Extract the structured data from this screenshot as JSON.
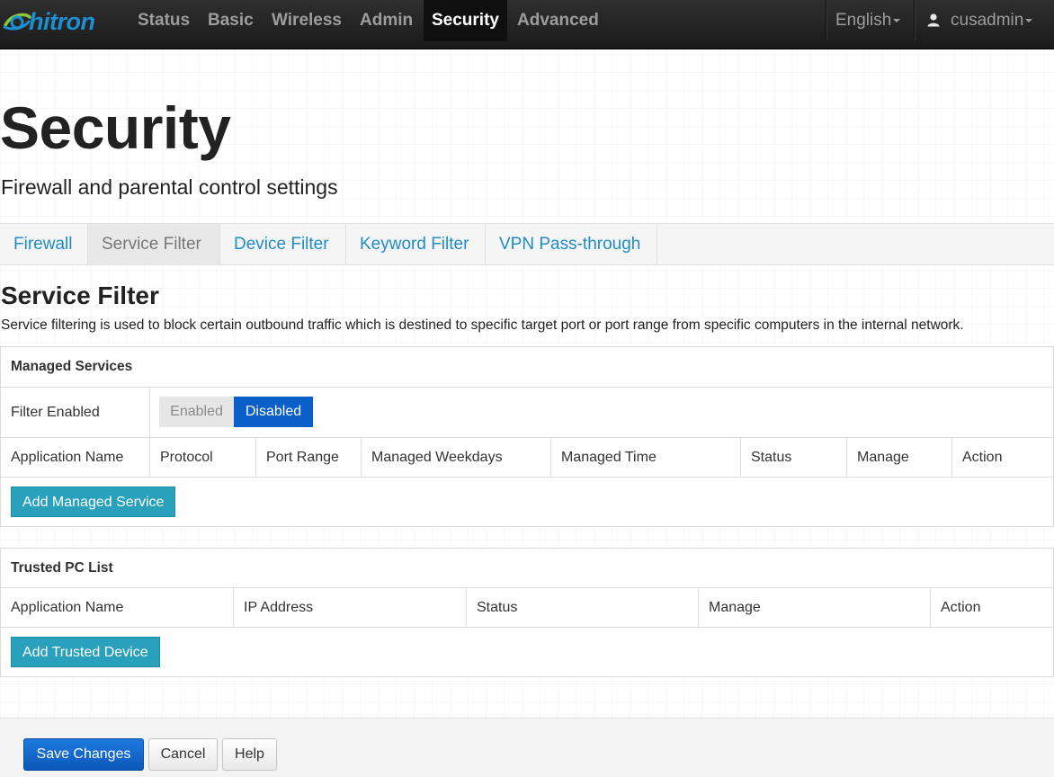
{
  "brand": {
    "name": "hitron"
  },
  "nav": {
    "items": [
      "Status",
      "Basic",
      "Wireless",
      "Admin",
      "Security",
      "Advanced"
    ],
    "active": "Security",
    "language": "English",
    "user": "cusadmin"
  },
  "page": {
    "title": "Security",
    "subtitle": "Firewall and parental control settings"
  },
  "tabs": {
    "items": [
      "Firewall",
      "Service Filter",
      "Device Filter",
      "Keyword Filter",
      "VPN Pass-through"
    ],
    "active": "Service Filter"
  },
  "section": {
    "title": "Service Filter",
    "description": "Service filtering is used to block certain outbound traffic which is destined to specific target port or port range from specific computers in the internal network."
  },
  "managed_services": {
    "heading": "Managed Services",
    "filter_label": "Filter Enabled",
    "toggle": {
      "enabled_label": "Enabled",
      "disabled_label": "Disabled",
      "selected": "Disabled"
    },
    "columns": [
      "Application Name",
      "Protocol",
      "Port Range",
      "Managed Weekdays",
      "Managed Time",
      "Status",
      "Manage",
      "Action"
    ],
    "add_button": "Add Managed Service"
  },
  "trusted_pc": {
    "heading": "Trusted PC List",
    "columns": [
      "Application Name",
      "IP Address",
      "Status",
      "Manage",
      "Action"
    ],
    "add_button": "Add Trusted Device"
  },
  "footer": {
    "save": "Save Changes",
    "cancel": "Cancel",
    "help": "Help"
  },
  "colors": {
    "navbar": "#1f1f1f",
    "brand": "#1c8fd0",
    "link": "#1f8cc8",
    "toggle_selected": "#0a5ec7",
    "action_button": "#2aa1bc",
    "primary_button": "#1068cf"
  },
  "icons": {
    "user": "user-icon",
    "language_dropdown": "caret-down-icon",
    "user_dropdown": "caret-down-icon"
  }
}
